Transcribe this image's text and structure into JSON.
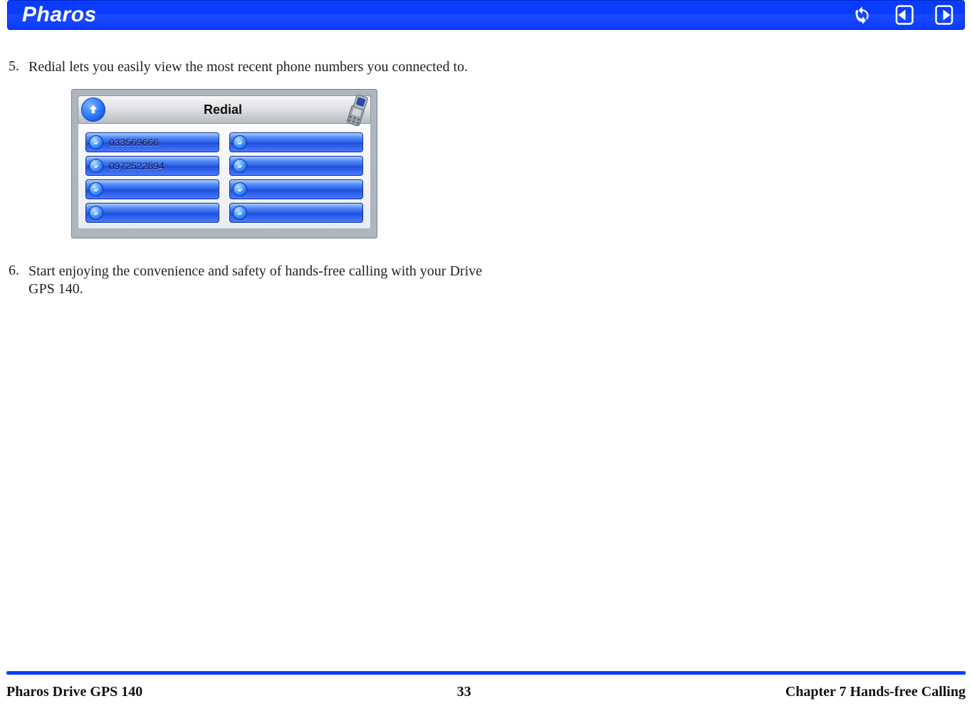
{
  "header": {
    "brand": "Pharos"
  },
  "steps": [
    {
      "n": "5.",
      "text": "Redial lets you easily view the most recent phone numbers you connected to."
    },
    {
      "n": "6.",
      "text": "Start enjoying the convenience and safety of hands-free calling with your Drive GPS 140."
    }
  ],
  "redial_screen": {
    "title": "Redial",
    "entries": [
      "033569666",
      "0972522894",
      "",
      "",
      "",
      "",
      "",
      ""
    ]
  },
  "footer": {
    "left": "Pharos Drive GPS 140",
    "center": "33",
    "right": "Chapter 7 Hands-free Calling"
  }
}
